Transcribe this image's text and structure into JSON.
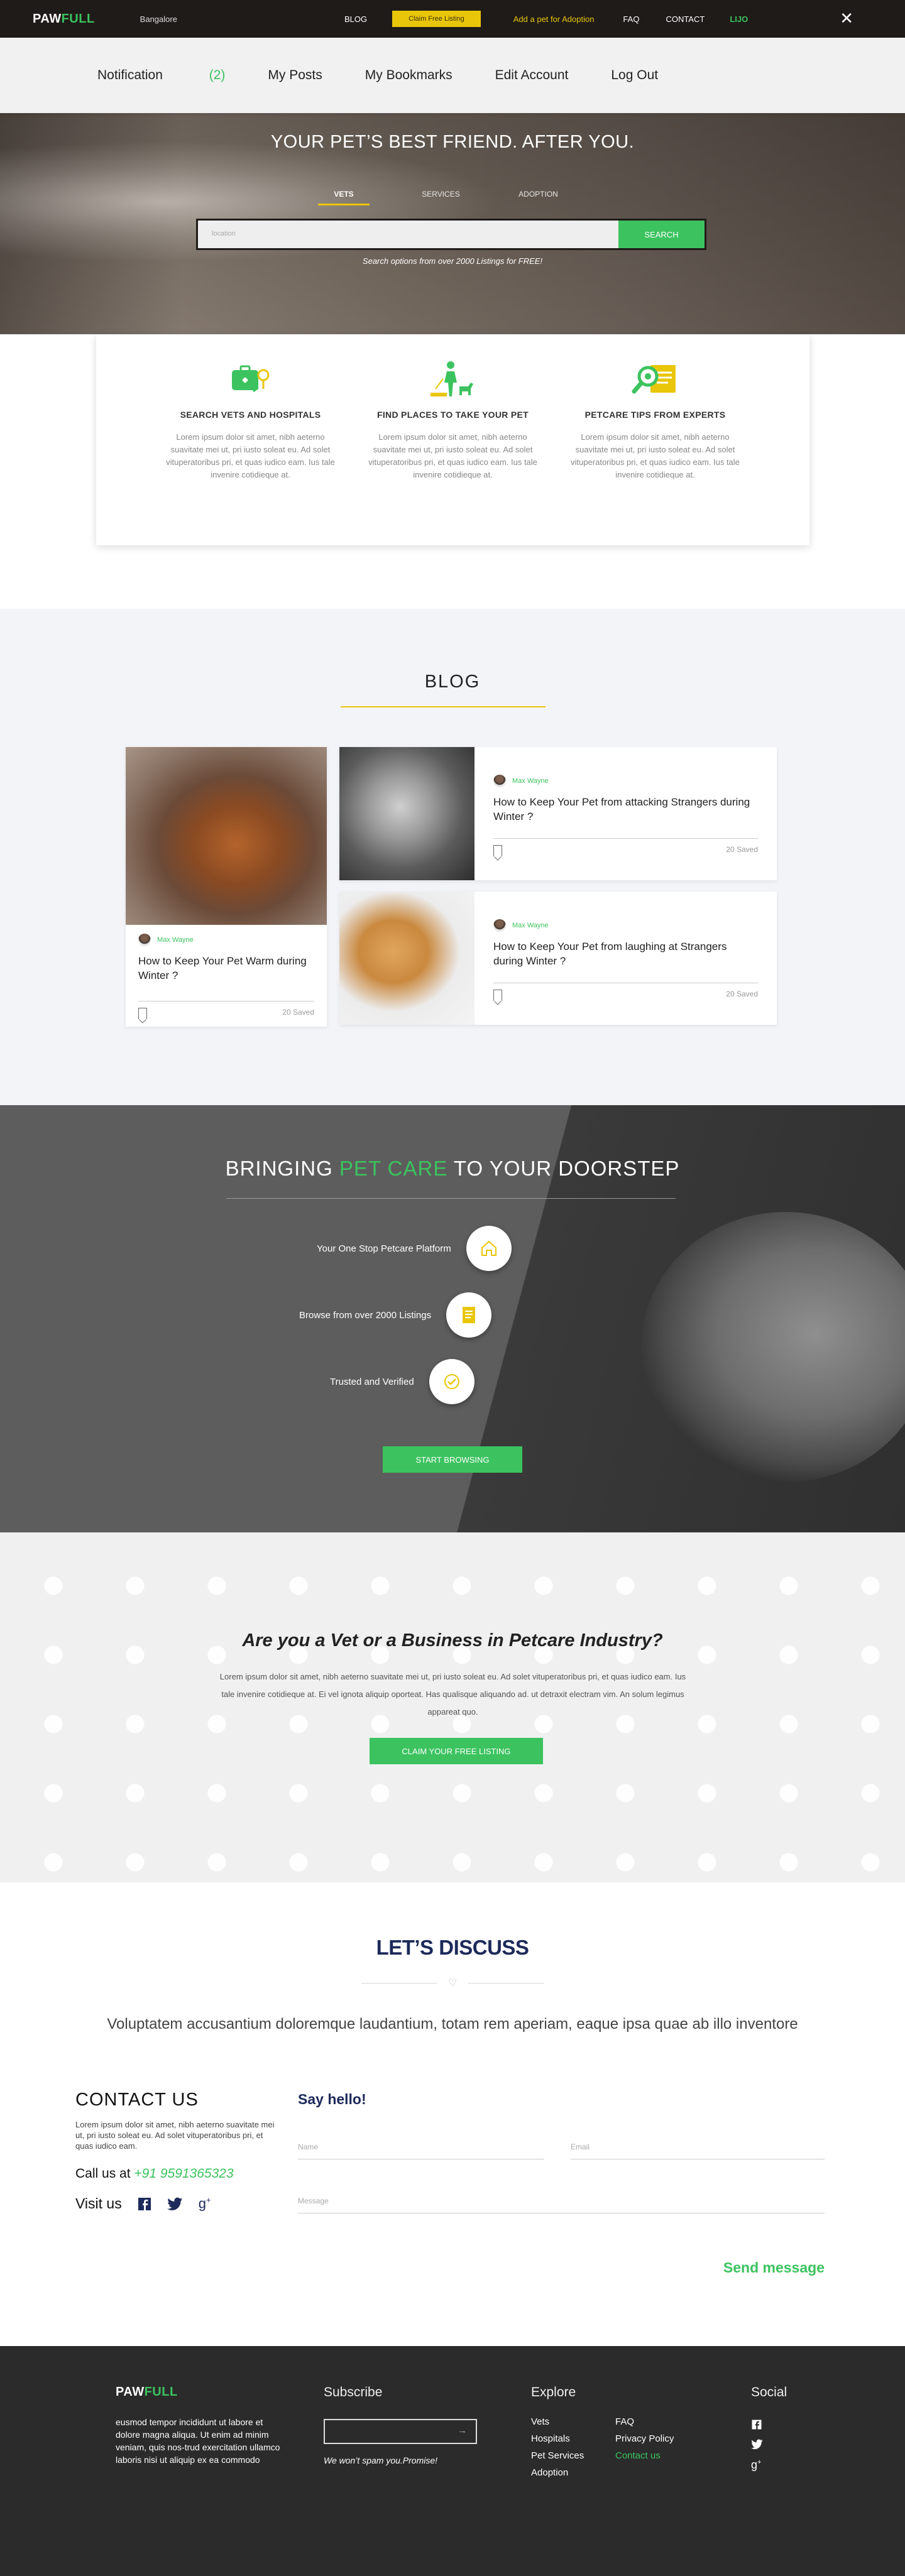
{
  "topbar": {
    "logo_a": "PAW",
    "logo_b": "FULL",
    "city": "Bangalore",
    "blog": "BLOG",
    "claim": "Claim Free Listing",
    "adopt": "Add a pet for Adoption",
    "faq": "FAQ",
    "contact": "CONTACT",
    "user": "LIJO",
    "close": "✕"
  },
  "subnav": {
    "notification": "Notification",
    "notification_count": "(2)",
    "posts": "My Posts",
    "bookmarks": "My Bookmarks",
    "edit": "Edit Account",
    "logout": "Log Out"
  },
  "hero": {
    "title": "YOUR PET’S BEST FRIEND. AFTER YOU.",
    "tabs": [
      "VETS",
      "SERVICES",
      "ADOPTION"
    ],
    "search_placeholder": "location",
    "search_button": "SEARCH",
    "note": "Search options from over 2000 Listings for FREE!"
  },
  "features": [
    {
      "title": "SEARCH VETS AND HOSPITALS",
      "text": "Lorem ipsum dolor sit amet, nibh aeterno suavitate mei ut, pri iusto soleat eu. Ad solet vituperatoribus pri, et quas iudico eam. Ius tale invenire cotidieque at."
    },
    {
      "title": "FIND PLACES TO TAKE YOUR PET",
      "text": "Lorem ipsum dolor sit amet, nibh aeterno suavitate mei ut, pri iusto soleat eu. Ad solet vituperatoribus pri, et quas iudico eam. Ius tale invenire cotidieque at."
    },
    {
      "title": "PETCARE TIPS FROM EXPERTS",
      "text": "Lorem ipsum dolor sit amet, nibh aeterno suavitate mei ut, pri iusto soleat eu. Ad solet vituperatoribus pri, et quas iudico eam. Ius tale invenire cotidieque at."
    }
  ],
  "blog": {
    "title": "BLOG",
    "posts": [
      {
        "author": "Max Wayne",
        "title": "How to Keep Your Pet Warm during Winter ?",
        "saved": "20 Saved"
      },
      {
        "author": "Max Wayne",
        "title": "How to Keep Your Pet from attacking Strangers during Winter ?",
        "saved": "20 Saved"
      },
      {
        "author": "Max Wayne",
        "title": "How to Keep Your Pet from laughing at Strangers during Winter ?",
        "saved": "20 Saved"
      }
    ]
  },
  "doorstep": {
    "title_a": "BRINGING ",
    "title_b": "PET CARE",
    "title_c": " TO YOUR DOORSTEP",
    "steps": [
      "Your One Stop Petcare Platform",
      "Browse from over 2000 Listings",
      "Trusted and Verified"
    ],
    "cta": "START BROWSING"
  },
  "vet": {
    "title": "Are you a Vet or a Business in Petcare Industry?",
    "text": "Lorem ipsum dolor sit amet, nibh aeterno suavitate mei ut, pri iusto soleat eu. Ad solet vituperatoribus pri, et quas iudico eam. Ius tale invenire cotidieque at. Ei vel ignota aliquip oporteat. Has qualisque aliquando ad. ut detraxit electram vim. An solum legimus appareat quo.",
    "cta": "CLAIM YOUR FREE LISTING"
  },
  "discuss": {
    "title": "LET’S DISCUSS",
    "heart": "♡",
    "lead": "Voluptatem accusantium doloremque laudantium, totam rem aperiam, eaque ipsa quae ab illo inventore",
    "contact_title": "CONTACT US",
    "contact_text": "Lorem ipsum dolor sit amet, nibh aeterno suavitate mei ut, pri iusto soleat eu. Ad solet vituperatoribus pri, et quas iudico eam.",
    "call_label": "Call us at ",
    "phone": "+91 9591365323",
    "visit": "Visit us",
    "say_hello": "Say hello!",
    "name_ph": "Name",
    "email_ph": "Email",
    "message_ph": "Message",
    "send": "Send message"
  },
  "footer": {
    "logo_a": "PAW",
    "logo_b": "FULL",
    "about": "eusmod tempor incididunt ut labore et dolore magna aliqua. Ut enim ad minim veniam, quis nos-trud exercitation ullamco laboris nisi ut aliquip ex ea commodo",
    "subscribe": "Subscribe",
    "spam": "We won’t spam you.Promise!",
    "explore": "Explore",
    "links": [
      "Vets",
      "FAQ",
      "Hospitals",
      "Privacy Policy",
      "Pet Services",
      "Contact us",
      "Adoption"
    ],
    "social": "Social"
  },
  "colors": {
    "accent": "#3cc35f",
    "yellow": "#e9c60a",
    "navy": "#1d2a5a",
    "dark": "#1f1b18"
  }
}
